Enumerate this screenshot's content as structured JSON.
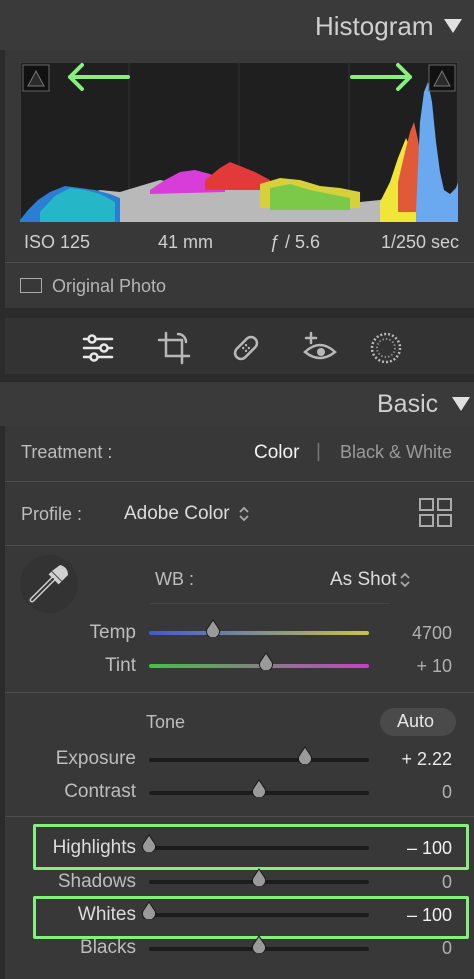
{
  "histogram": {
    "title": "Histogram",
    "meta": {
      "iso": "ISO 125",
      "focal": "41 mm",
      "aperture": "ƒ / 5.6",
      "shutter": "1/250 sec"
    },
    "original_photo_label": "Original Photo"
  },
  "tools": [
    "edit-sliders-icon",
    "crop-icon",
    "heal-icon",
    "red-eye-icon",
    "mask-icon"
  ],
  "basic": {
    "title": "Basic",
    "treatment_label": "Treatment :",
    "treatment_color": "Color",
    "treatment_separator": "|",
    "treatment_bw": "Black & White",
    "profile_label": "Profile :",
    "profile_value": "Adobe Color",
    "wb_label": "WB :",
    "wb_value": "As Shot",
    "tone_label": "Tone",
    "auto_label": "Auto",
    "sliders": {
      "temp": {
        "label": "Temp",
        "value": "4700",
        "position": 0.29
      },
      "tint": {
        "label": "Tint",
        "value": "+ 10",
        "position": 0.53
      },
      "exposure": {
        "label": "Exposure",
        "value": "+ 2.22",
        "position": 0.71
      },
      "contrast": {
        "label": "Contrast",
        "value": "0",
        "position": 0.5
      },
      "highlights": {
        "label": "Highlights",
        "value": "– 100",
        "position": 0.0
      },
      "shadows": {
        "label": "Shadows",
        "value": "0",
        "position": 0.5
      },
      "whites": {
        "label": "Whites",
        "value": "– 100",
        "position": 0.0
      },
      "blacks": {
        "label": "Blacks",
        "value": "0",
        "position": 0.5
      }
    }
  },
  "colors": {
    "highlight": "#86f07e",
    "arrow": "#86f07e"
  }
}
